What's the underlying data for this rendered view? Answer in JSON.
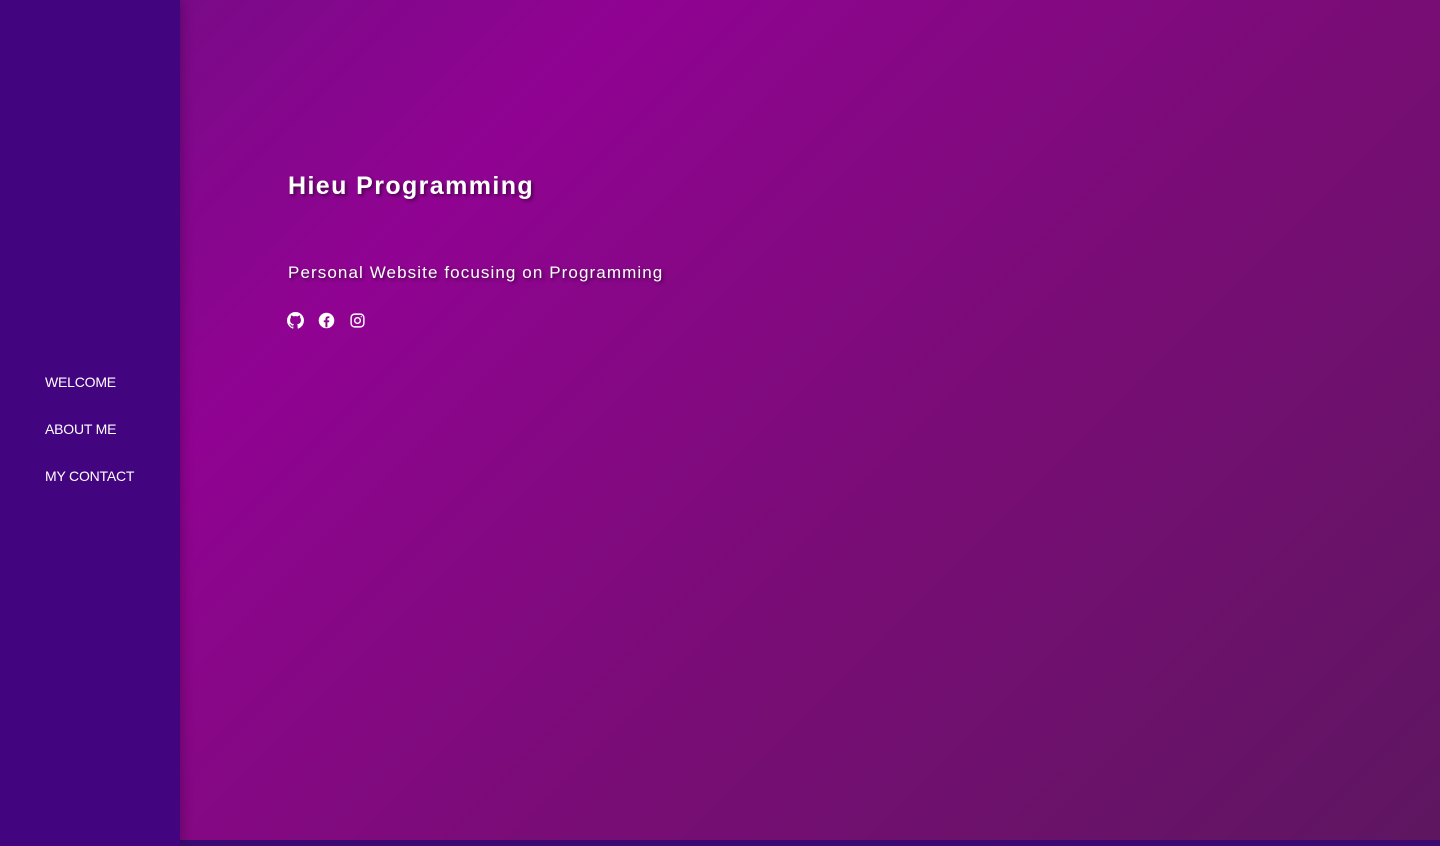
{
  "sidebar": {
    "items": [
      {
        "label": "WELCOME"
      },
      {
        "label": "ABOUT ME"
      },
      {
        "label": "MY CONTACT"
      }
    ]
  },
  "hero": {
    "title": "Hieu Programming",
    "subtitle": "Personal Website focusing on Programming",
    "socials": [
      {
        "icon": "github-icon"
      },
      {
        "icon": "facebook-icon"
      },
      {
        "icon": "instagram-icon"
      }
    ]
  },
  "colors": {
    "sidebar": "#430480",
    "accent": "#900392",
    "text": "#ffffff"
  }
}
